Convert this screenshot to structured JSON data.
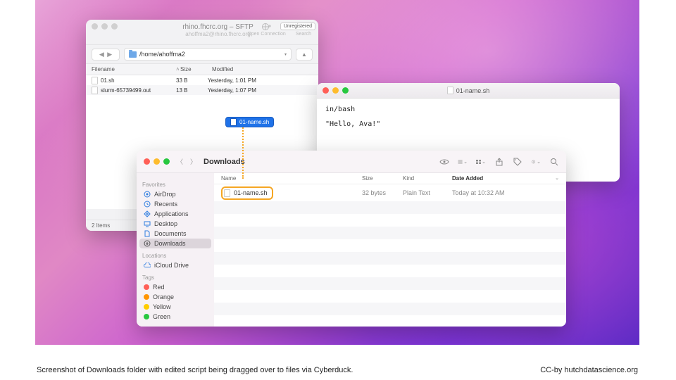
{
  "sftp": {
    "title": "rhino.fhcrc.org – SFTP",
    "subtitle": "ahoffma2@rhino.fhcrc.org",
    "open_conn": "Open Connection",
    "search": "Search",
    "unregistered": "Unregistered",
    "path": "/home/ahoffma2",
    "col_name": "Filename",
    "col_size": "Size",
    "col_mod": "Modified",
    "rows": [
      {
        "name": "01.sh",
        "size": "33 B",
        "mod": "Yesterday, 1:01 PM"
      },
      {
        "name": "slurm-65739499.out",
        "size": "13 B",
        "mod": "Yesterday, 1:07 PM"
      }
    ],
    "status": "2 Items"
  },
  "drag_label": "01-name.sh",
  "editor": {
    "title": "01-name.sh",
    "line1": "in/bash",
    "line2": "\"Hello, Ava!\""
  },
  "finder": {
    "title": "Downloads",
    "sections": {
      "favorites": "Favorites",
      "locations": "Locations",
      "tags": "Tags"
    },
    "favorites": [
      "AirDrop",
      "Recents",
      "Applications",
      "Desktop",
      "Documents",
      "Downloads"
    ],
    "locations": [
      "iCloud Drive"
    ],
    "tags": [
      {
        "label": "Red",
        "color": "#ff5f57"
      },
      {
        "label": "Orange",
        "color": "#ff9500"
      },
      {
        "label": "Yellow",
        "color": "#ffcc00"
      },
      {
        "label": "Green",
        "color": "#28c840"
      }
    ],
    "cols": {
      "name": "Name",
      "size": "Size",
      "kind": "Kind",
      "date": "Date Added"
    },
    "row": {
      "name": "01-name.sh",
      "size": "32 bytes",
      "kind": "Plain Text",
      "date": "Today at 10:32 AM"
    }
  },
  "caption": "Screenshot of Downloads folder with edited script being dragged over to files via Cyberduck.",
  "attribution": "CC-by hutchdatascience.org"
}
